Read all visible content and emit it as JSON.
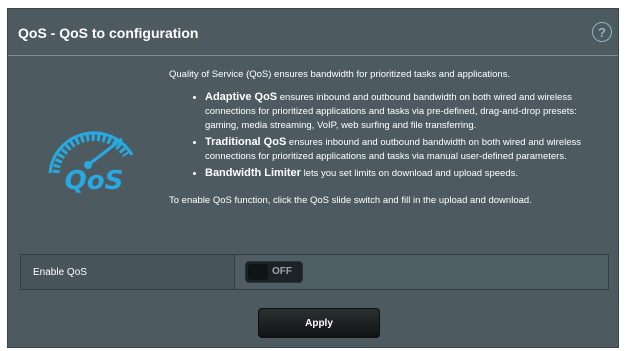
{
  "header": {
    "title": "QoS - QoS to configuration",
    "help_glyph": "?"
  },
  "logo": {
    "text": "QoS",
    "icon": "speedometer-qos-icon",
    "color": "#28a9e0"
  },
  "description": {
    "intro": "Quality of Service (QoS) ensures bandwidth for prioritized tasks and applications.",
    "items": [
      {
        "name": "Adaptive QoS",
        "text": " ensures inbound and outbound bandwidth on both wired and wireless connections for prioritized applications and tasks via pre-defined, drag-and-drop presets: gaming, media streaming, VoIP, web surfing and file transferring."
      },
      {
        "name": "Traditional QoS",
        "text": " ensures inbound and outbound bandwidth on both wired and wireless connections for prioritized applications and tasks via manual user-defined parameters."
      },
      {
        "name": "Bandwidth Limiter",
        "text": " lets you set limits on download and upload speeds."
      }
    ],
    "enable_note": "To enable QoS function, click the QoS slide switch and fill in the upload and download."
  },
  "enable_qos": {
    "label": "Enable QoS",
    "state": "OFF"
  },
  "apply_label": "Apply",
  "colors": {
    "panel": "#4d5b61",
    "accent": "#28a9e0"
  }
}
